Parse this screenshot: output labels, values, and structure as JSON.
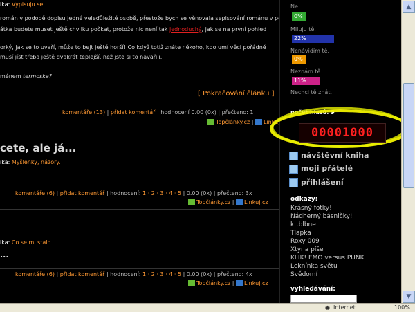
{
  "article1": {
    "category_prefix": "ika:",
    "category": "Vypisuju se",
    "line1_a": "román v podobě dopisu jedné veleďůležité osobě, přestože bych se věnovala sepisování románu v podobě",
    "line2_a": "átka budete muset ještě chvilku počkat, protože nic není tak ",
    "line2_link": "jednoduchý",
    "line2_b": ", jak se na první pohled",
    "line3": "orký, jak se to uvaří, může to bejt ještě horší! Co když totiž znáte někoho, kdo umí věci pořádně",
    "line4": "musí jíst třeba ještě dvakrát teplejší, než jste si to navařili.",
    "line5_a": "ménem ",
    "line5_b": "termoska?",
    "continue": "[ Pokračování článku ]",
    "comments": "komentáře (13)",
    "add_comment": "přidat komentář",
    "rating": "| hodnocení 0.00 (0x) | přečteno: 1",
    "top": "Topčlánky.cz",
    "linkuj": "Linkuj.cz"
  },
  "article2": {
    "title": "cete, ale já...",
    "category_prefix": "ika:",
    "category": "Myšlenky, názory.",
    "comments": "komentáře (6)",
    "add_comment": "přidat komentář",
    "rating_label": "| hodnocení:",
    "rating_links": "1 · 2 · 3 · 4 · 5",
    "rating_value": "| 0.00 (0x) | přečteno: 3x",
    "top": "Topčlánky.cz",
    "linkuj": "Linkuj.cz"
  },
  "article3": {
    "category_prefix": "ika:",
    "category": "Co se mi stalo",
    "ellipsis": "...",
    "comments": "komentáře (6)",
    "add_comment": "přidat komentář",
    "rating_label": "| hodnocení:",
    "rating_links": "1 · 2 · 3 · 4 · 5",
    "rating_value": "| 0.00 (0x) | přečteno: 4x",
    "top": "Topčlánky.cz",
    "linkuj": "Linkuj.cz"
  },
  "poll": {
    "options": [
      {
        "label": "Ne.",
        "value": "0%",
        "color": "#33aa33"
      },
      {
        "label": "Miluju tě.",
        "value": "22%",
        "color": "#2233aa"
      },
      {
        "label": "Nenávidím tě.",
        "value": "0%",
        "color": "#ee9900"
      },
      {
        "label": "Neznám tě.",
        "value": "11%",
        "color": "#cc2288"
      },
      {
        "label": "Nechci tě znát.",
        "value": "",
        "color": ""
      }
    ],
    "total": "počet hlasů: 9"
  },
  "counter": "00001000",
  "menu": {
    "guestbook": "návštěvní kniha",
    "friends": "moji přátelé",
    "login": "přihlášení"
  },
  "odkazy": {
    "title": "odkazy:",
    "items": [
      "Krásný fotky!",
      "Nádherný básničky!",
      "kt.blbne",
      "Tlapka",
      "Roxy 009",
      "Xtyna píše",
      "KLIK! EMO versus PUNK",
      "Leknínka světu",
      "Svědomí"
    ]
  },
  "search": {
    "title": "vyhledávání:",
    "placeholder": ""
  },
  "status": {
    "zone": "Internet",
    "zoom": "100%"
  }
}
